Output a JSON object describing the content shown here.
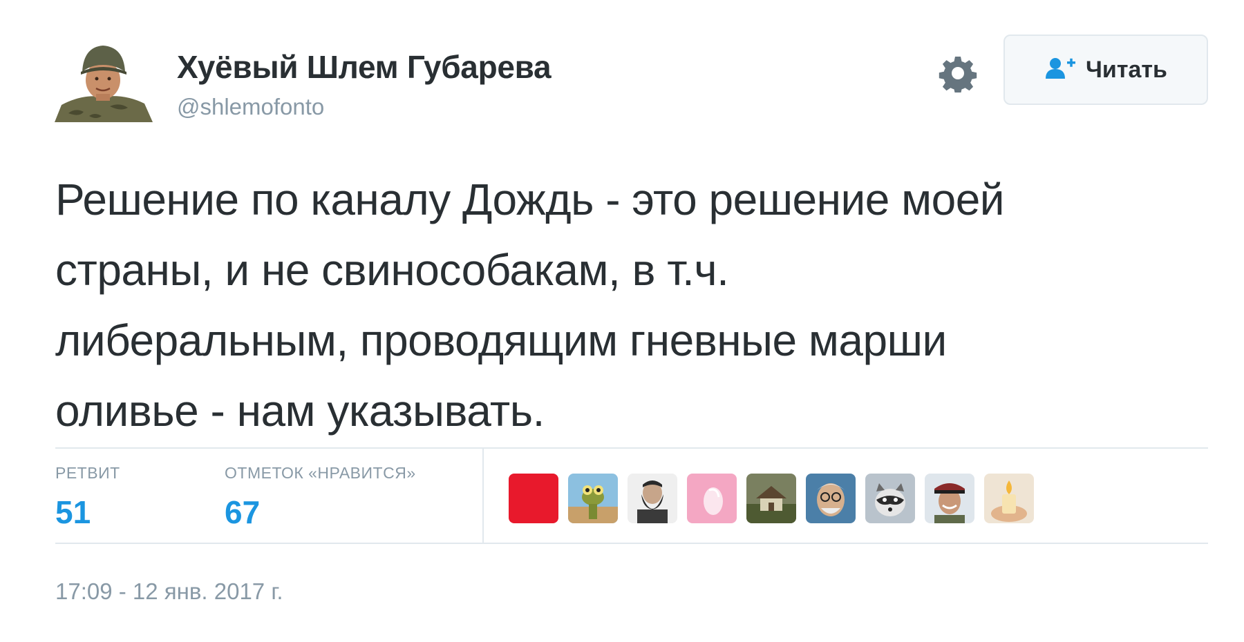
{
  "author": {
    "name": "Хуёвый Шлем Губарева",
    "handle": "@shlemofonto",
    "avatar_icon": "soldier-helmet-avatar"
  },
  "follow_button": {
    "label": "Читать",
    "icon": "add-user-icon"
  },
  "settings_icon": "gear-icon",
  "tweet_lines": [
    "Решение по каналу Дождь - это решение моей",
    "страны, и не свинособакам, в т.ч.",
    "либеральным, проводящим гневные марши",
    "оливье - нам указывать."
  ],
  "stats": {
    "retweets_label": "РЕТВИТ",
    "retweets_count": "51",
    "likes_label": "ОТМЕТОК «НРАВИТСЯ»",
    "likes_count": "67"
  },
  "likers": [
    {
      "icon": "red-square-avatar",
      "color": "#e8192c"
    },
    {
      "icon": "lizard-avatar",
      "color": "#6aa3c8"
    },
    {
      "icon": "bearded-man-avatar",
      "color": "#3a3a3a"
    },
    {
      "icon": "pink-feather-avatar",
      "color": "#f4a7c3"
    },
    {
      "icon": "house-painting-avatar",
      "color": "#6f6a4e"
    },
    {
      "icon": "old-man-glasses-avatar",
      "color": "#4b7fa8"
    },
    {
      "icon": "raccoon-avatar",
      "color": "#9aa7b3"
    },
    {
      "icon": "officer-avatar",
      "color": "#8a2a2a"
    },
    {
      "icon": "candle-avatar",
      "color": "#d9a65c"
    }
  ],
  "timestamp": "17:09 - 12 янв. 2017 г.",
  "colors": {
    "text": "#292f33",
    "muted": "#8899a6",
    "accent": "#1b95e0",
    "border": "#e1e8ed"
  }
}
